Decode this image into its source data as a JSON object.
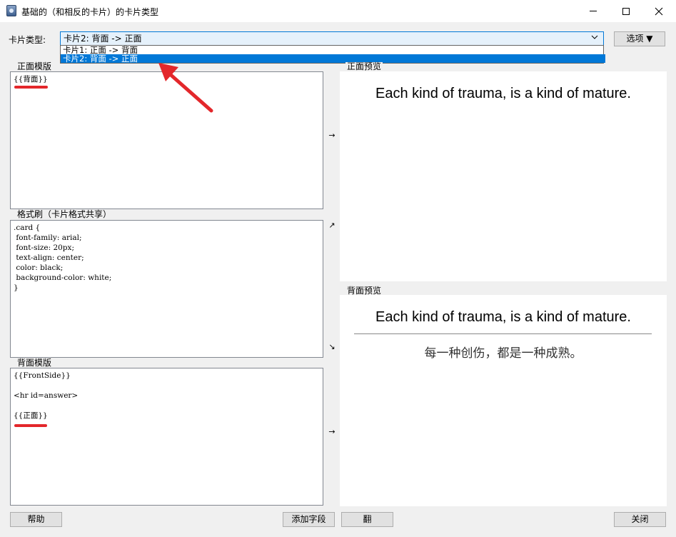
{
  "window": {
    "title": "基础的（和相反的卡片）的卡片类型",
    "app_icon": "app-icon",
    "controls": [
      "minimize-icon",
      "maximize-icon",
      "close-icon"
    ]
  },
  "card_type": {
    "label": "卡片类型:",
    "selected": "卡片2: 背面 -> 正面",
    "options": [
      "卡片1: 正面 -> 背面",
      "卡片2: 背面 -> 正面"
    ],
    "highlighted_index": 1
  },
  "options_button": "选项 ▼",
  "front_template": {
    "label": "正面模版",
    "content": "{{背面}}"
  },
  "styling": {
    "label": "格式刷（卡片格式共享）",
    "content": ".card {\n font-family: arial;\n font-size: 20px;\n text-align: center;\n color: black;\n background-color: white;\n}"
  },
  "back_template": {
    "label": "背面模版",
    "content": "{{FrontSide}}\n\n<hr id=answer>\n\n{{正面}}"
  },
  "arrows": {
    "front": "→",
    "style_up": "↗",
    "style_down": "↘",
    "back": "→"
  },
  "front_preview": {
    "label": "正面预览",
    "text": "Each kind of trauma, is a kind of mature."
  },
  "back_preview": {
    "label": "背面预览",
    "question": "Each kind of trauma, is a kind of mature.",
    "answer": "每一种创伤，都是一种成熟。"
  },
  "buttons": {
    "help": "帮助",
    "add_field": "添加字段",
    "flip": "翻",
    "close": "关闭"
  },
  "colors": {
    "accent": "#0078d7",
    "annotation_red": "#e3272b",
    "background": "#f0f0f0"
  }
}
